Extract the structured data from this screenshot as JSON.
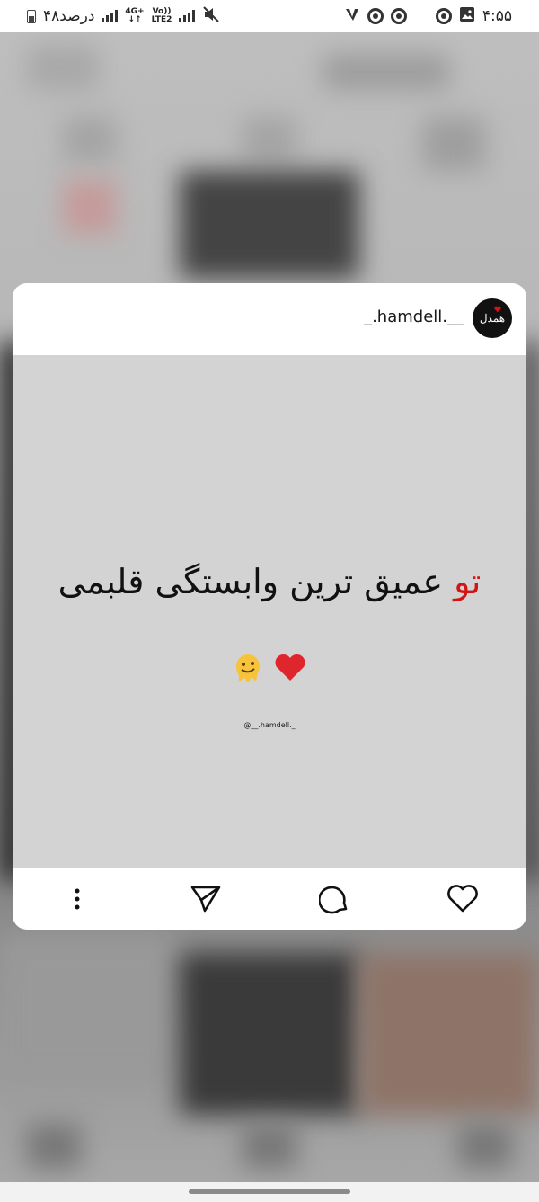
{
  "status_bar": {
    "battery_text": "۴۸درصد",
    "network_top": "4G+",
    "network_arrows": "↓↑",
    "volte_top": "Vo))",
    "volte_bottom": "LTE2",
    "time": "۴:۵۵",
    "icons": [
      "battery-icon",
      "signal-icon",
      "network-4g-icon",
      "volte-icon",
      "signal-icon",
      "mute-icon",
      "v-app-icon",
      "chrome-icon",
      "chrome-icon",
      "chrome-icon",
      "gallery-icon"
    ]
  },
  "post_card": {
    "username": "_.hamdell.__",
    "avatar_text": "همدل",
    "post_image": {
      "text_red": "تو",
      "text_main": "عمیق ترین وابستگی قلبمی",
      "emojis": [
        "heart-emoji",
        "melting-face-emoji"
      ],
      "watermark": "@__.hamdell._"
    },
    "actions": [
      "more-options-icon",
      "share-icon",
      "comment-icon",
      "like-icon"
    ]
  },
  "colors": {
    "card_bg": "#ffffff",
    "post_bg": "#d3d3d3",
    "accent_red": "#d21414",
    "heart_red": "#e0262d"
  }
}
